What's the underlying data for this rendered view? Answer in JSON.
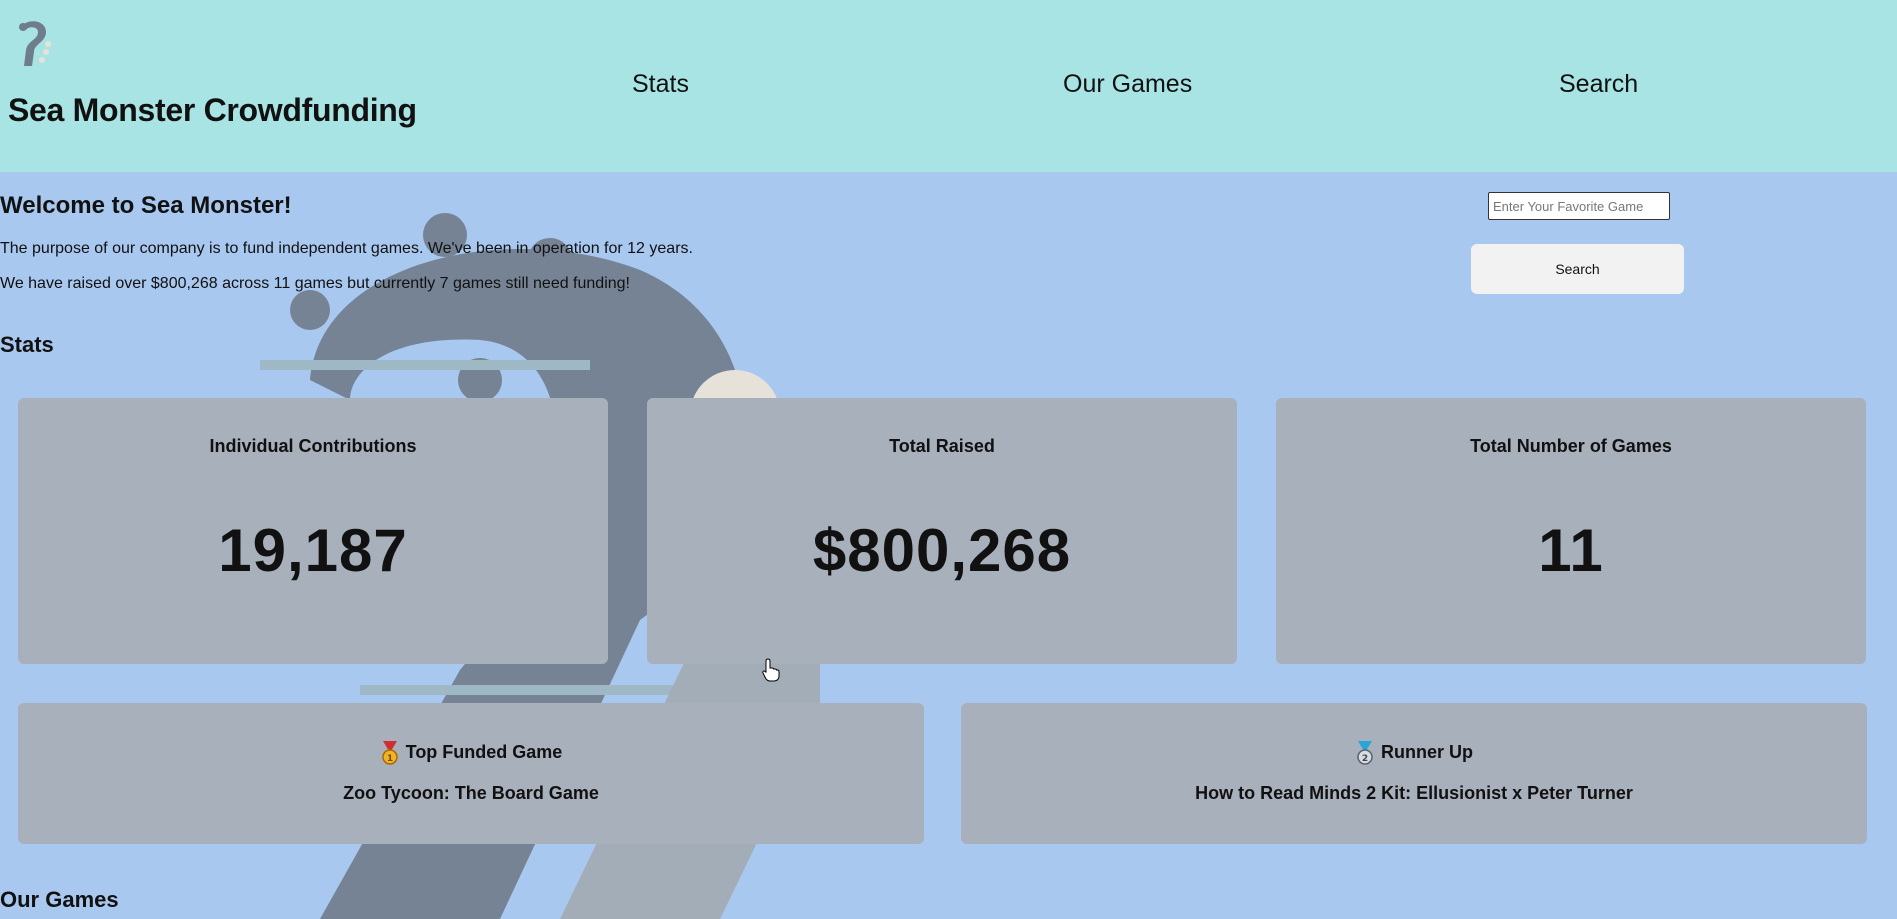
{
  "header": {
    "title": "Sea Monster Crowdfunding",
    "nav": [
      "Stats",
      "Our Games",
      "Search"
    ]
  },
  "icons": {
    "logo": "sea-monster-tentacle-logo",
    "top_medal": "gold-medal-icon",
    "runner_medal": "silver-medal-icon"
  },
  "welcome": {
    "title": "Welcome to Sea Monster!",
    "line1": "The purpose of our company is to fund independent games. We've been in operation for 12 years.",
    "line2": "We have raised over $800,268 across 11 games but currently 7 games still need funding!"
  },
  "search": {
    "placeholder": "Enter Your Favorite Game",
    "button_label": "Search"
  },
  "stats": {
    "section_title": "Stats",
    "cards": [
      {
        "label": "Individual Contributions",
        "value": "19,187"
      },
      {
        "label": "Total Raised",
        "value": "$800,268"
      },
      {
        "label": "Total Number of Games",
        "value": "11"
      }
    ]
  },
  "funded": {
    "top": {
      "label": "Top Funded Game",
      "name": "Zoo Tycoon: The Board Game"
    },
    "runner_up": {
      "label": "Runner Up",
      "name": "How to Read Minds 2 Kit: Ellusionist x Peter Turner"
    }
  },
  "games": {
    "section_title": "Our Games"
  },
  "colors": {
    "header_bg": "#a8e4e4",
    "page_bg": "#a8c8f0",
    "card_bg": "#a8b0bc",
    "button_bg": "#f2f2f2"
  }
}
